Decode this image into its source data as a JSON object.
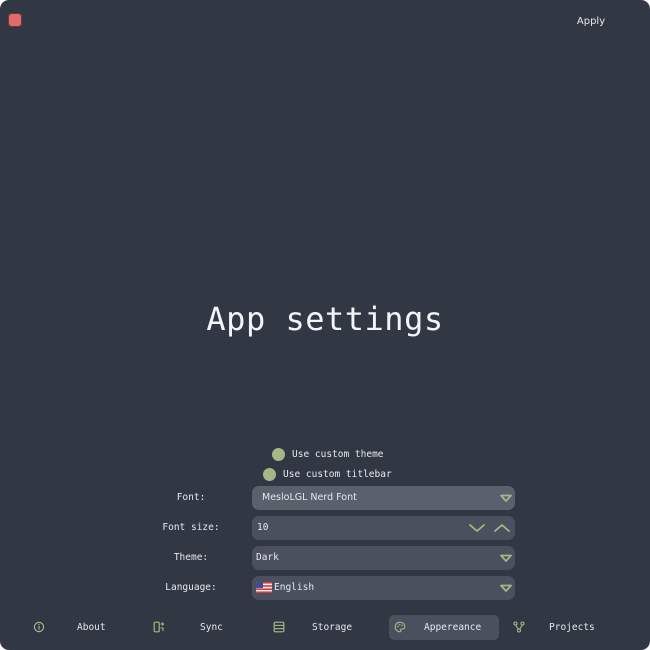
{
  "window": {
    "title": "App settings",
    "apply_label": "Apply",
    "close_icon": "close-icon"
  },
  "toggles": {
    "custom_theme": {
      "label": "Use custom theme",
      "checked": true
    },
    "custom_titlebar": {
      "label": "Use custom titlebar",
      "checked": true
    }
  },
  "settings": {
    "font": {
      "label": "Font:",
      "value": "MesloLGL Nerd Font"
    },
    "font_size": {
      "label": "Font size:",
      "value": "10"
    },
    "theme": {
      "label": "Theme:",
      "value": "Dark"
    },
    "language": {
      "label": "Language:",
      "value": "English",
      "flag_icon": "us-flag-icon"
    }
  },
  "tabs": [
    {
      "label": "About",
      "icon": "info-icon",
      "active": false
    },
    {
      "label": "Sync",
      "icon": "sync-icon",
      "active": false
    },
    {
      "label": "Storage",
      "icon": "storage-icon",
      "active": false
    },
    {
      "label": "Appereance",
      "icon": "palette-icon",
      "active": true
    },
    {
      "label": "Projects",
      "icon": "branch-icon",
      "active": false
    }
  ],
  "colors": {
    "background": "#323744",
    "field": "#4a505d",
    "accent": "#a7b686",
    "close": "#e26b6b",
    "text": "#e6e9ef"
  }
}
